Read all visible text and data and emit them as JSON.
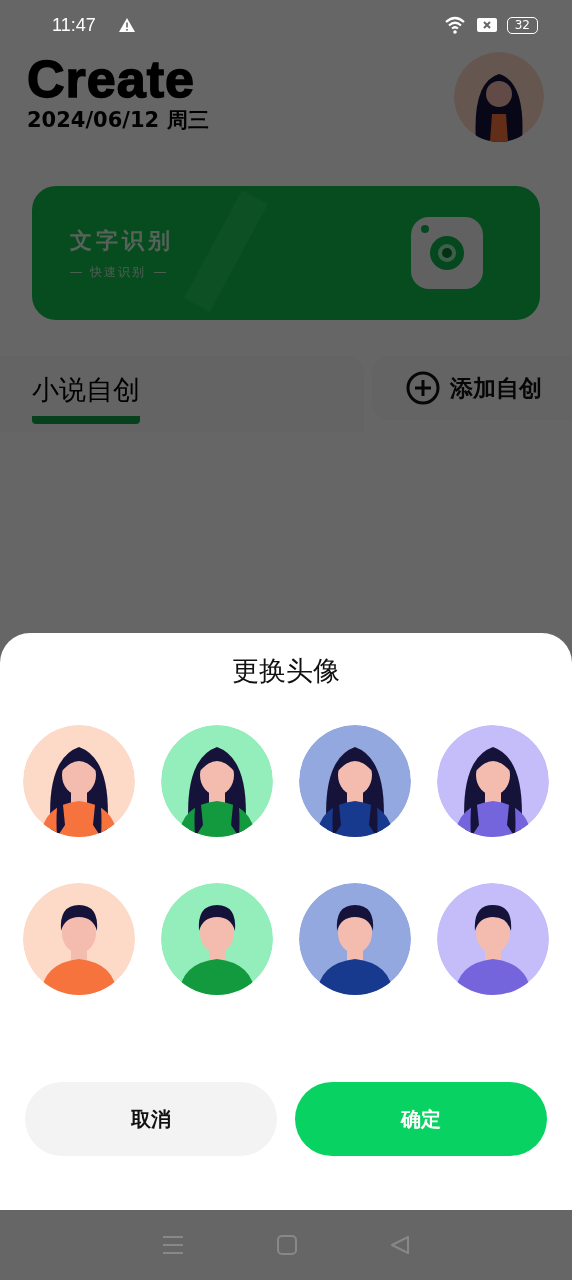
{
  "status_bar": {
    "time": "11:47",
    "battery": "32"
  },
  "header": {
    "title": "Create",
    "date": "2024/06/12 周三"
  },
  "banner": {
    "title": "文字识别",
    "subtitle": "快速识别"
  },
  "tabs": [
    {
      "label": "小说自创",
      "selected": true
    }
  ],
  "add_button": {
    "label": "添加自创"
  },
  "dialog": {
    "title": "更换头像",
    "avatars": [
      {
        "kind": "long-hair",
        "color": "#fdd9c8"
      },
      {
        "kind": "long-hair",
        "color": "#94eebc"
      },
      {
        "kind": "long-hair",
        "color": "#94a8e0"
      },
      {
        "kind": "long-hair",
        "color": "#c4bdfa"
      },
      {
        "kind": "short-hair",
        "color": "#fdd9c8"
      },
      {
        "kind": "short-hair",
        "color": "#94eebc"
      },
      {
        "kind": "short-hair",
        "color": "#94a8e0"
      },
      {
        "kind": "short-hair",
        "color": "#c4bdfa"
      }
    ],
    "buttons": [
      {
        "kind": "cancel",
        "label": "取消"
      },
      {
        "kind": "confirm",
        "label": "确定"
      }
    ]
  }
}
